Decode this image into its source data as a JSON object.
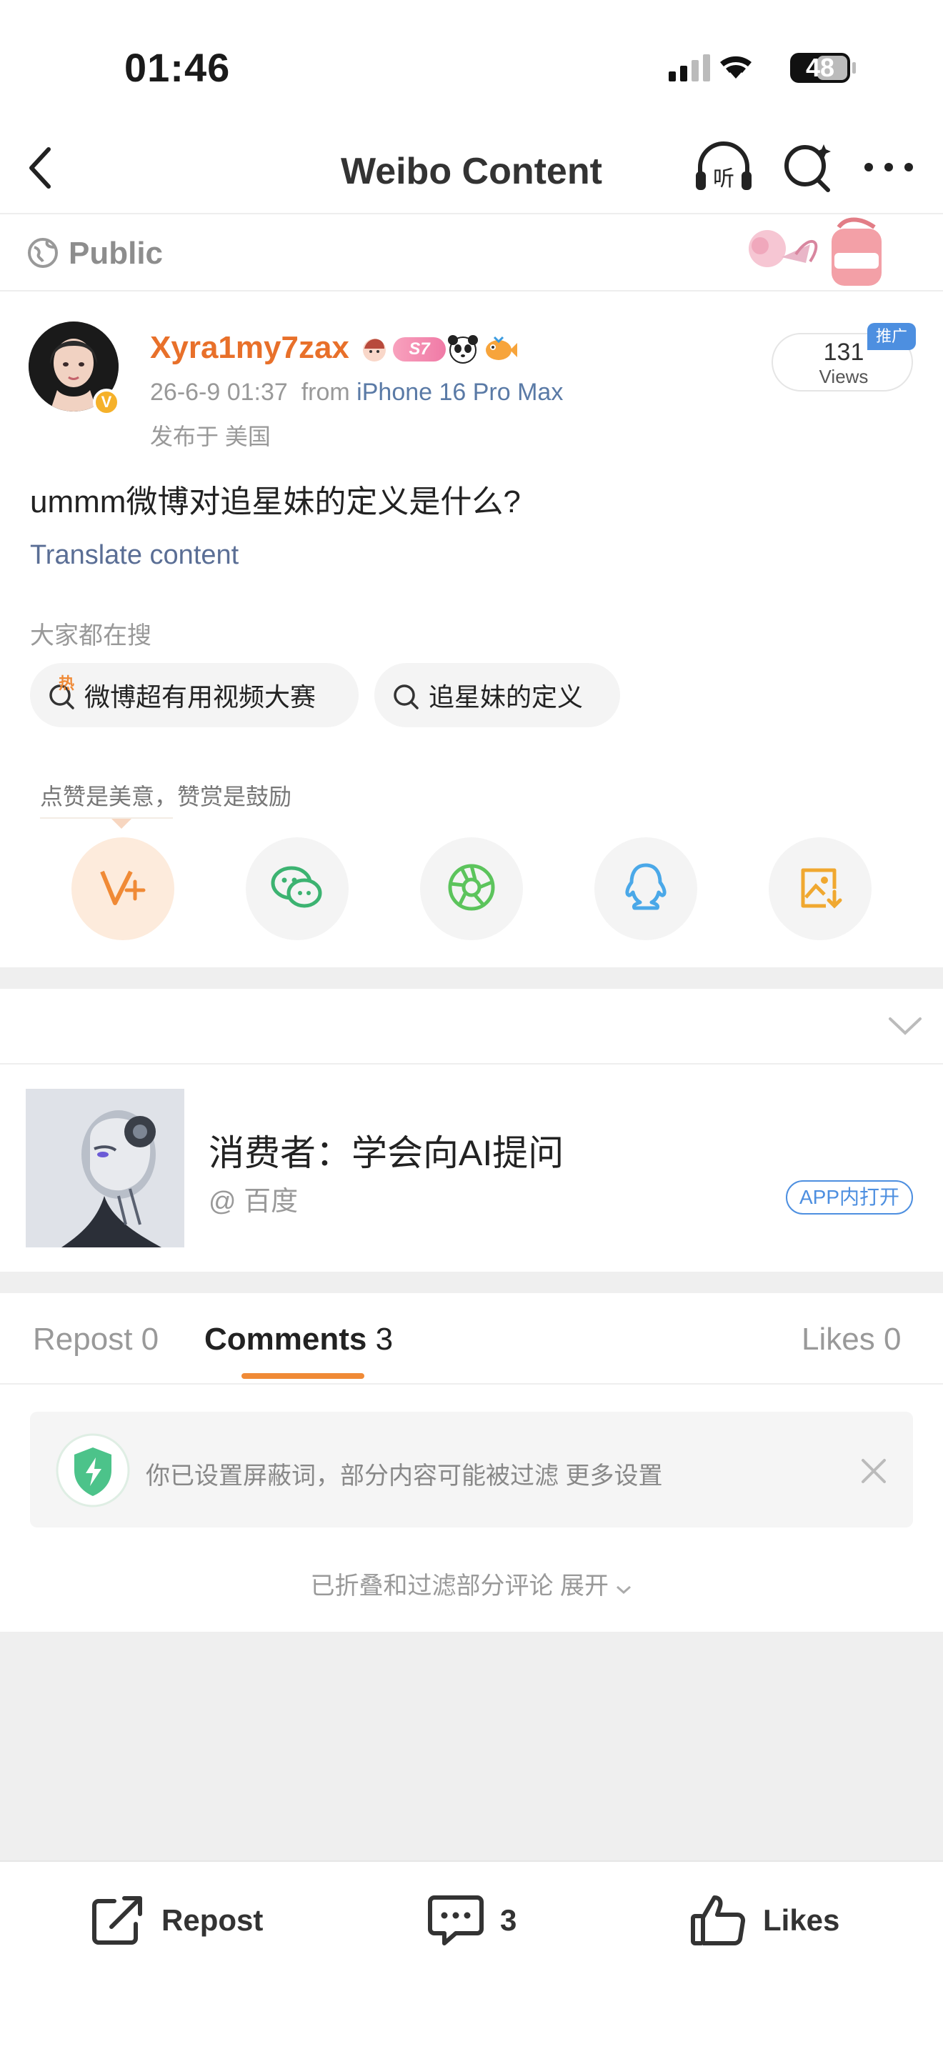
{
  "status_bar": {
    "time": "01:46",
    "battery": "48"
  },
  "nav": {
    "title": "Weibo Content",
    "listen_label": "听"
  },
  "visibility": {
    "label": "Public"
  },
  "post": {
    "username": "Xyra1my7zax",
    "level_badge": "S7",
    "datetime": "26-6-9 01:37",
    "from_label": "from",
    "device": "iPhone 16 Pro Max",
    "location": "发布于 美国",
    "views_count": "131",
    "views_label": "Views",
    "promo_tag": "推广",
    "text": "ummm微博对追星妹的定义是什么?",
    "translate_label": "Translate content"
  },
  "search": {
    "hint": "大家都在搜",
    "chips": [
      {
        "label": "微博超有用视频大赛",
        "hot": true,
        "hot_badge": "热"
      },
      {
        "label": "追星妹的定义",
        "hot": false
      }
    ]
  },
  "reward_tip": "点赞是美意，赞赏是鼓励",
  "share_buttons": [
    {
      "name": "reward",
      "color": "#f08a36"
    },
    {
      "name": "wechat",
      "color": "#3cb371"
    },
    {
      "name": "moments",
      "color": "#5cc45c"
    },
    {
      "name": "qq",
      "color": "#4aa8e8"
    },
    {
      "name": "save-image",
      "color": "#f0a830"
    }
  ],
  "ad": {
    "title": "消费者：学会向AI提问",
    "source": "@ 百度",
    "open_label": "APP内打开"
  },
  "tabs": [
    {
      "label": "Repost",
      "count": "0"
    },
    {
      "label": "Comments",
      "count": "3"
    },
    {
      "label": "Likes",
      "count": "0"
    }
  ],
  "filter_notice": {
    "text": "你已设置屏蔽词，部分内容可能被过滤",
    "link": "更多设置"
  },
  "fold_notice": {
    "text": "已折叠和过滤部分评论",
    "expand": "展开"
  },
  "bottom_bar": {
    "repost_label": "Repost",
    "comment_count": "3",
    "likes_label": "Likes"
  }
}
